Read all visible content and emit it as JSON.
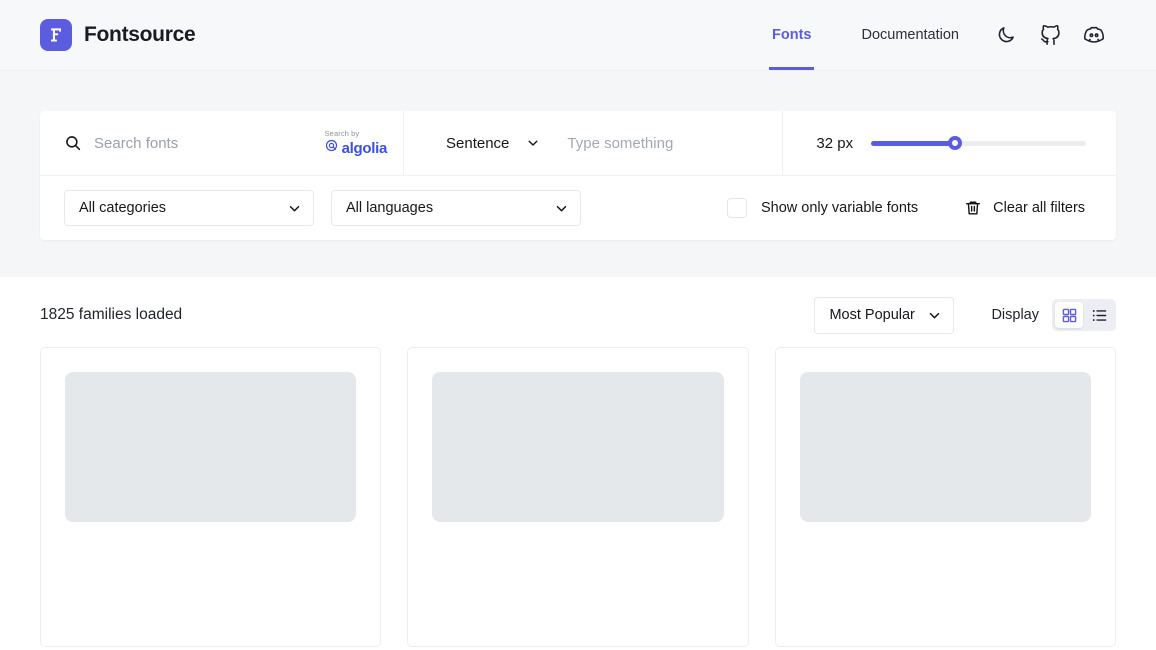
{
  "header": {
    "brand_name": "Fontsource",
    "brand_logo_letter": "F",
    "nav": [
      {
        "label": "Fonts",
        "active": true
      },
      {
        "label": "Documentation",
        "active": false
      }
    ],
    "icons": [
      {
        "name": "moon-icon",
        "title": "Toggle dark mode"
      },
      {
        "name": "github-icon",
        "title": "GitHub"
      },
      {
        "name": "discord-icon",
        "title": "Discord"
      }
    ],
    "accent_color": "#5C5CE0"
  },
  "filters": {
    "search": {
      "placeholder": "Search fonts",
      "value": "",
      "icon": "search-icon",
      "algolia_prefix": "Search by",
      "algolia_name": "algolia",
      "algolia_color": "#3C4FE0"
    },
    "preview": {
      "mode_label": "Sentence",
      "text_placeholder": "Type something",
      "text_value": ""
    },
    "size": {
      "label": "32 px",
      "value": 32,
      "min": 8,
      "max": 70,
      "fill_percent": 39
    },
    "category_select": "All categories",
    "language_select": "All languages",
    "variable_fonts": {
      "label": "Show only variable fonts",
      "checked": false
    },
    "clear_filters": {
      "label": "Clear all filters",
      "icon": "trash-icon"
    }
  },
  "results": {
    "count_label": "1825 families loaded",
    "sort_label": "Most Popular",
    "display_label": "Display",
    "view_modes": [
      {
        "name": "grid-view",
        "active": true
      },
      {
        "name": "list-view",
        "active": false
      }
    ],
    "cards": [
      {
        "state": "loading"
      },
      {
        "state": "loading"
      },
      {
        "state": "loading"
      }
    ]
  }
}
